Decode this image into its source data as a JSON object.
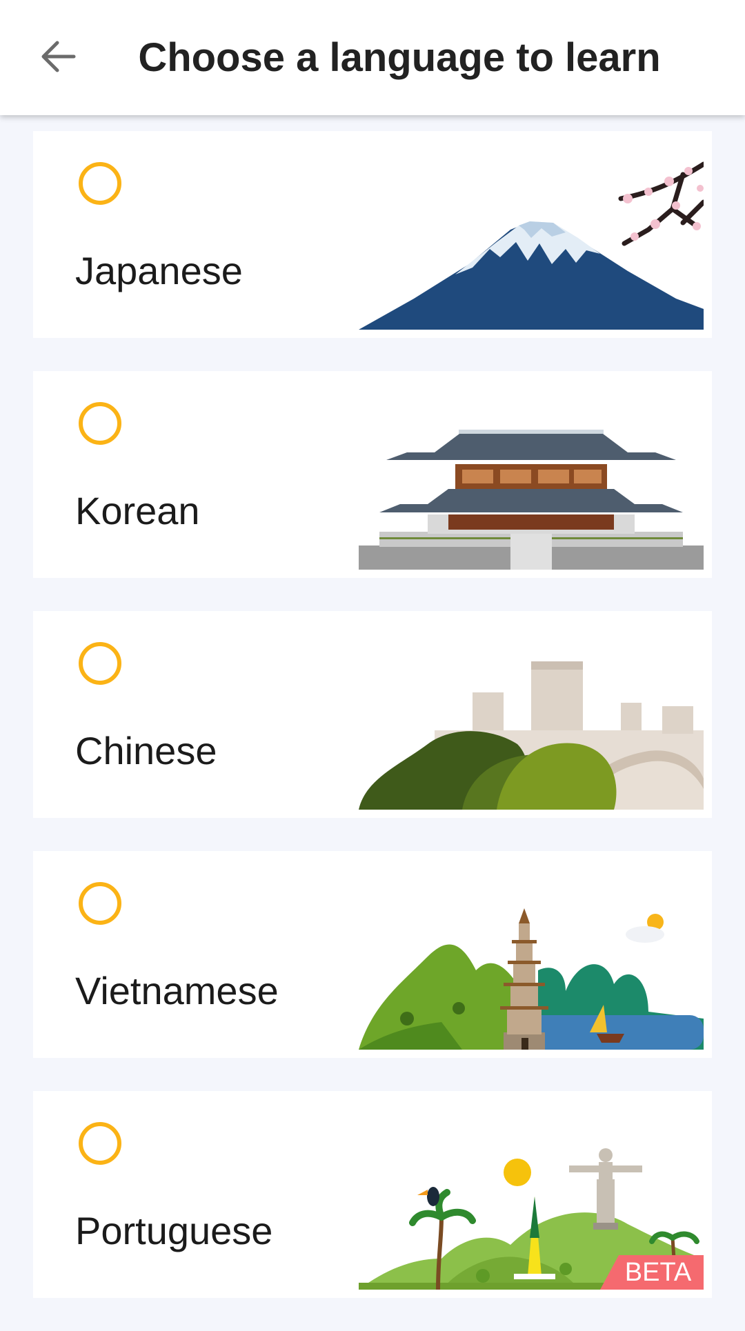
{
  "header": {
    "title": "Choose a language to learn",
    "back_icon": "arrow-left-icon"
  },
  "languages": [
    {
      "label": "Japanese",
      "selected": false,
      "illustration": "mount-fuji-icon"
    },
    {
      "label": "Korean",
      "selected": false,
      "illustration": "korean-palace-icon"
    },
    {
      "label": "Chinese",
      "selected": false,
      "illustration": "great-wall-icon"
    },
    {
      "label": "Vietnamese",
      "selected": false,
      "illustration": "pagoda-icon"
    },
    {
      "label": "Portuguese",
      "selected": false,
      "illustration": "christ-redeemer-icon",
      "badge": "BETA"
    }
  ],
  "colors": {
    "accent": "#fbb316",
    "background": "#f4f6fc",
    "badge": "#f56a6f"
  }
}
